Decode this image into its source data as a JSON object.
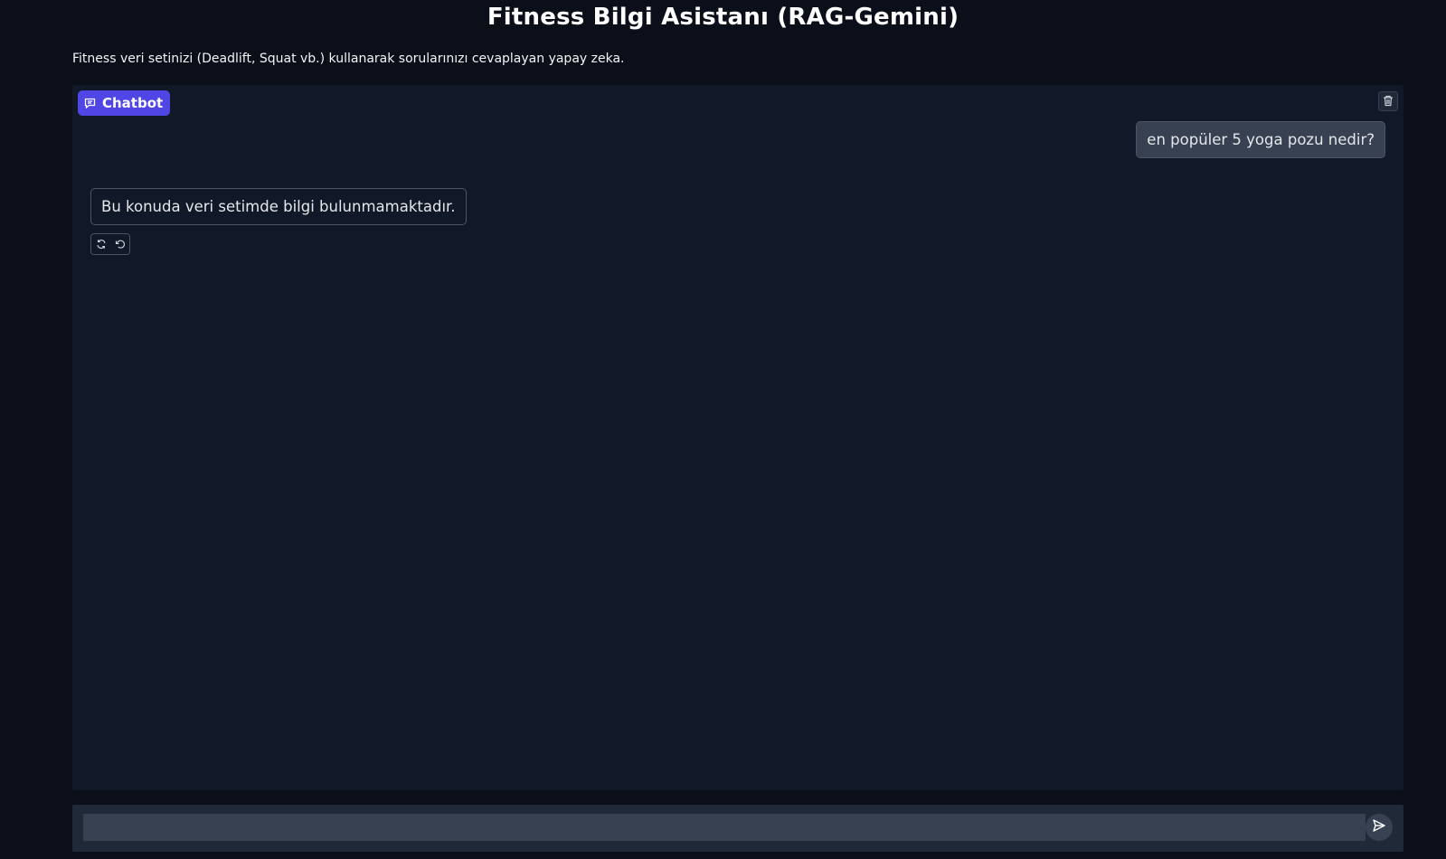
{
  "page": {
    "title": "Fitness Bilgi Asistanı (RAG-Gemini)",
    "description": "Fitness veri setinizi (Deadlift, Squat vb.) kullanarak sorularınızı cevaplayan yapay zeka."
  },
  "chatbot": {
    "label": "Chatbot",
    "label_icon": "chat-icon",
    "clear_icon": "trash-icon",
    "messages": [
      {
        "role": "user",
        "text": "en popüler 5 yoga pozu nedir?"
      },
      {
        "role": "assistant",
        "text": "Bu konuda veri setimde bilgi bulunmamaktadır."
      }
    ],
    "message_actions": [
      "retry-icon",
      "undo-icon"
    ]
  },
  "input": {
    "value": "",
    "placeholder": "",
    "send_icon": "send-icon"
  },
  "colors": {
    "background": "#0b0f19",
    "panel": "#111827",
    "accent": "#4f46e5",
    "input": "#374151"
  }
}
